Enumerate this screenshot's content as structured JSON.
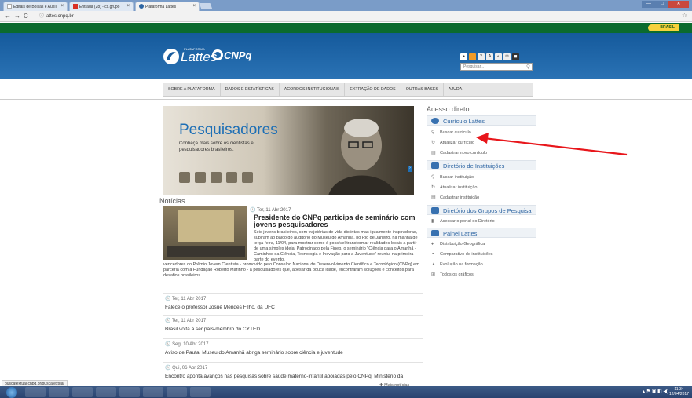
{
  "browser": {
    "tabs": [
      {
        "label": "Editais de Bolsas e Auxíl",
        "active": false
      },
      {
        "label": "Entrada (28) - cs.grupo",
        "active": false
      },
      {
        "label": "Plataforma Lattes",
        "active": true
      }
    ],
    "address": "lattes.cnpq.br",
    "window_controls": [
      "—",
      "□",
      "✕"
    ]
  },
  "gov_bar": {
    "label": "BRASIL"
  },
  "header": {
    "plataforma": "Plataforma",
    "lattes": "Lattes",
    "cnpq": "CNPq",
    "search_placeholder": "Pesquisar..."
  },
  "menu": [
    "SOBRE A PLATAFORMA",
    "DADOS E ESTATÍSTICAS",
    "ACORDOS INSTITUCIONAIS",
    "EXTRAÇÃO DE DADOS",
    "OUTRAS BASES",
    "AJUDA"
  ],
  "banner": {
    "title": "Pesquisadores",
    "subtitle": "Conheça mais sobre os cientistas e pesquisadores brasileiros."
  },
  "news": {
    "section_title": "Notícias",
    "main": {
      "date": "Ter, 11 Abr 2017",
      "title": "Presidente do CNPq participa de seminário com jovens pesquisadores",
      "body": "Seis jovens brasileiros, com trajetórias de vida distintas mas igualmente inspiradoras, subiram ao palco do auditório do Museu do Amanhã, no Rio de Janeiro, na manhã de terça-feira, 11/04, para mostrar como é possível transformar realidades locais a partir de uma simples ideia. Patrocinado pela Finep, o seminário \"Ciência para o Amanhã - Caminhos da Ciência, Tecnologia e Inovação para a Juventude\" reuniu, na primeira parte do evento,",
      "body2": "vencedores do Prêmio Jovem Cientista - promovido pelo Conselho Nacional de Desenvolvimento Científico e Tecnológico (CNPq) em parceria com a Fundação Roberto Marinho - a pesquisadores que, apesar da pouca idade, encontraram soluções e conceitos para desafios brasileiros."
    },
    "items": [
      {
        "date": "Ter, 11 Abr 2017",
        "title": "Falece o professor Josué Mendes Filho, da UFC"
      },
      {
        "date": "Ter, 11 Abr 2017",
        "title": "Brasil volta a ser país-membro do CYTED"
      },
      {
        "date": "Seg, 10 Abr 2017",
        "title": "Aviso de Pauta: Museu do Amanhã abriga seminário sobre ciência e juventude"
      },
      {
        "date": "Qui, 06 Abr 2017",
        "title": "Encontro aponta avanços nas pesquisas sobre saúde materno-infantil apoiadas pelo CNPq, Ministério da"
      }
    ],
    "more": "Mais notícias"
  },
  "sidebar": {
    "title": "Acesso direto",
    "sections": [
      {
        "header": "Currículo Lattes",
        "items": [
          "Buscar currículo",
          "Atualizar currículo",
          "Cadastrar novo currículo"
        ]
      },
      {
        "header": "Diretório de Instituições",
        "items": [
          "Buscar instituição",
          "Atualizar instituição",
          "Cadastrar instituição"
        ]
      },
      {
        "header": "Diretório dos Grupos de Pesquisa",
        "items": [
          "Acessar o portal do Diretório"
        ]
      },
      {
        "header": "Painel Lattes",
        "items": [
          "Distribuição Geográfica",
          "Comparativo de instituições",
          "Evolução na formação",
          "Todos os gráficos"
        ]
      }
    ]
  },
  "status_bar": "buscatextual.cnpq.br/buscatextual",
  "taskbar": {
    "time": "11:34",
    "date": "12/04/2017"
  },
  "colors": {
    "gov_green": "#0b6b2e",
    "header_blue": "#1a5c9d",
    "accent": "#2f66a3",
    "annotation_arrow": "#e8161b"
  }
}
